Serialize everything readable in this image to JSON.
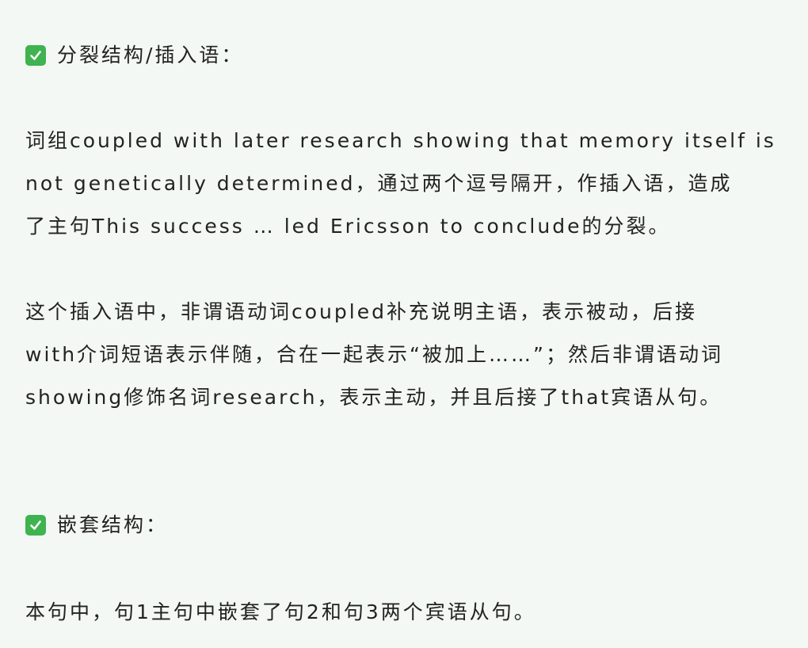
{
  "section1": {
    "heading": "分裂结构/插入语：",
    "paragraph1": [
      "词组coupled with later research showing that memory itself is",
      "not genetically determined，通过两个逗号隔开，作插入语，造成",
      "了主句This success … led Ericsson to conclude的分裂。"
    ],
    "paragraph2": [
      "这个插入语中，非谓语动词coupled补充说明主语，表示被动，后接",
      "with介词短语表示伴随，合在一起表示“被加上……”；然后非谓语动词",
      "showing修饰名词research，表示主动，并且后接了that宾语从句。"
    ]
  },
  "section2": {
    "heading": "嵌套结构：",
    "paragraph1": [
      "本句中，句1主句中嵌套了句2和句3两个宾语从句。"
    ]
  },
  "colors": {
    "background": "#f3f8f4",
    "text": "#222222",
    "check_green": "#3fb34f"
  },
  "icons": {
    "heading_marker": "check-mark-button-icon"
  }
}
